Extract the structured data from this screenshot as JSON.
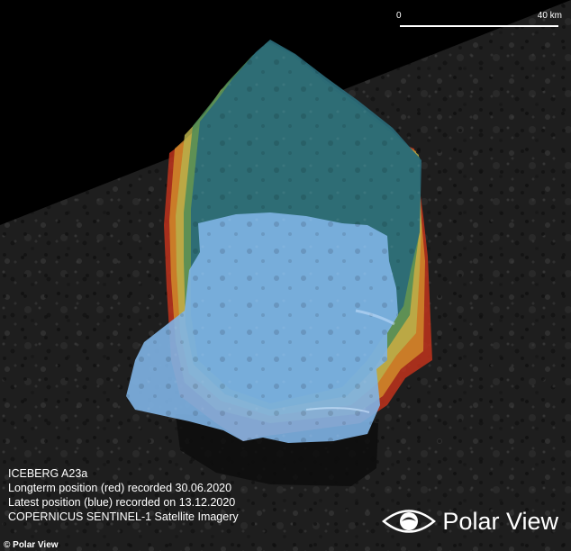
{
  "scale_bar": {
    "start_label": "0",
    "end_label": "40 km"
  },
  "caption": {
    "line1": "ICEBERG A23a",
    "line2": "Longterm position (red) recorded 30.06.2020",
    "line3": "Latest position (blue) recorded on 13.12.2020",
    "line4": "COPERNICUS SENTINEL-1 Satellite Imagery"
  },
  "brand": {
    "name": "Polar View",
    "icon": "eye-icon"
  },
  "credit": "© Polar View",
  "colors": {
    "longterm_outline": "#c0321c",
    "latest_outline": "#7fb4e6",
    "intermediate_1": "#d08a2a",
    "intermediate_2": "#b9b04a",
    "intermediate_3": "#4e8c57",
    "intermediate_4": "#2a6a78"
  }
}
